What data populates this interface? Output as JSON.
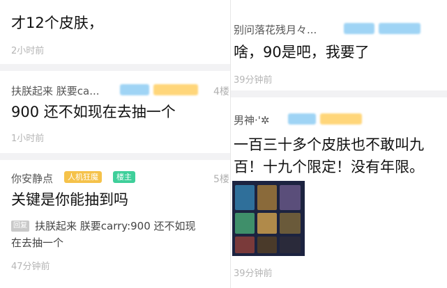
{
  "post1": {
    "content": "才12个皮肤，",
    "time": "2小时前"
  },
  "post2": {
    "user": "扶朕起来 朕要ca...",
    "floor": "4楼",
    "content": "900 还不如现在去抽一个",
    "time": "1小时前"
  },
  "post3": {
    "user": "你安静点",
    "tag_role": "人机狂魔",
    "tag_owner": "楼主",
    "floor": "5楼",
    "content": "关键是你能抽到吗",
    "reply_label": "回复",
    "reply_line1": "扶朕起来 朕要carry:900 还不如现",
    "reply_line2": "在去抽一个",
    "time": "47分钟前"
  },
  "post4": {
    "user": "别问落花残月々...",
    "content": "啥，90是吧，我要了",
    "time": "39分钟前"
  },
  "post5": {
    "user": "男神·'✲",
    "content_line1": "一百三十多个皮肤也不敢叫九",
    "content_line2": "百！十九个限定！没有年限。",
    "time": "39分钟前"
  },
  "colors": {
    "badge_blue": "#9fd4f5",
    "badge_gold": "#ffd67a",
    "tag_gold": "#f5c24a",
    "tag_green": "#3fcf9a"
  }
}
